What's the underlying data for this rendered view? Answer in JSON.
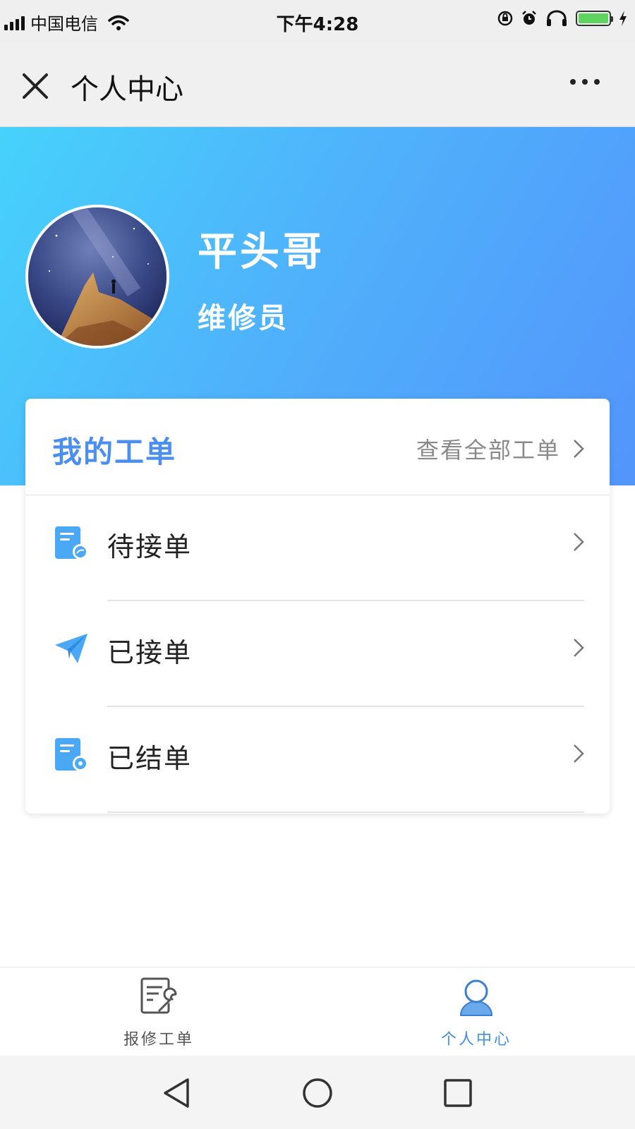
{
  "status_bar": {
    "carrier": "中国电信",
    "time": "下午4:28",
    "battery_level": 1.0
  },
  "nav": {
    "title": "个人中心"
  },
  "profile": {
    "name": "平头哥",
    "role": "维修员"
  },
  "orders": {
    "title": "我的工单",
    "view_all": "查看全部工单",
    "items": [
      {
        "label": "待接单",
        "icon": "pending-order-icon"
      },
      {
        "label": "已接单",
        "icon": "paper-plane-icon"
      },
      {
        "label": "已结单",
        "icon": "completed-order-icon"
      }
    ]
  },
  "tabs": [
    {
      "label": "报修工单",
      "icon": "repair-order-icon",
      "active": false
    },
    {
      "label": "个人中心",
      "icon": "user-icon",
      "active": true
    }
  ],
  "colors": {
    "accent": "#4a8ef0",
    "tab_active": "#3f8fe6",
    "tab_inactive": "#555555",
    "header_gradient": [
      "#46d2fb",
      "#5395fb"
    ]
  }
}
